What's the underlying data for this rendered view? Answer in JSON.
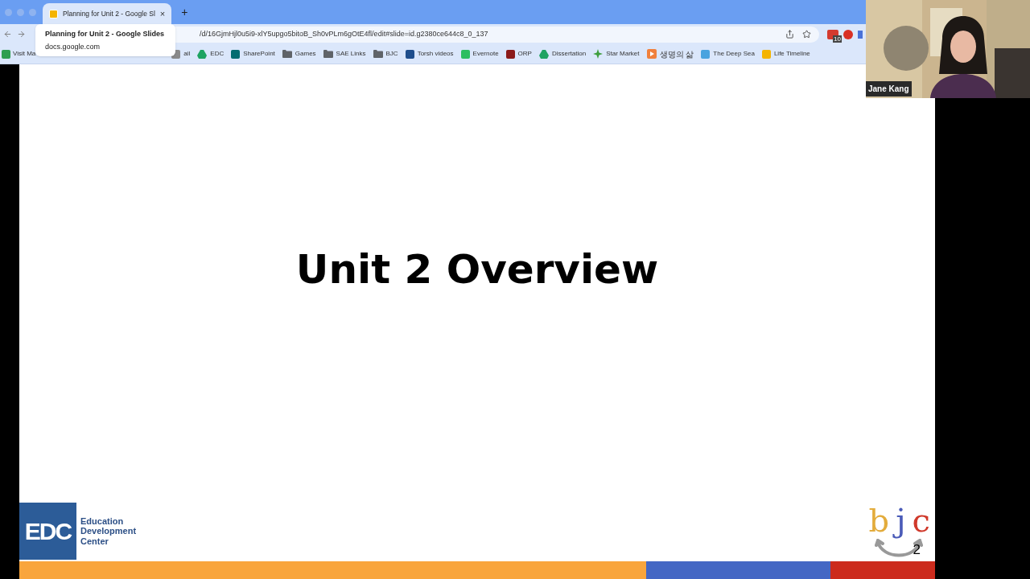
{
  "browser": {
    "tab": {
      "title": "Planning for Unit 2 - Google Sl",
      "close": "×",
      "selected": true
    },
    "new_tab": "+",
    "tooltip": {
      "title": "Planning for Unit 2 - Google Slides",
      "domain": "docs.google.com"
    },
    "url": "/d/16GjmHjl0u5i9-xlY5upgo5bitoB_Sh0vPLm6gOtE4fl/edit#slide=id.g2380ce644c8_0_137",
    "extension_badge": "10",
    "bookmarks": [
      {
        "label": "Visit Ma",
        "kind": "page",
        "color": "#2e9e4f"
      },
      {
        "label": "ail",
        "kind": "page",
        "color": "#8a8a8a"
      },
      {
        "label": "EDC",
        "kind": "drive",
        "color": "#1ea362"
      },
      {
        "label": "SharePoint",
        "kind": "page",
        "color": "#036c70"
      },
      {
        "label": "Games",
        "kind": "folder",
        "color": "#5f6368"
      },
      {
        "label": "SAE Links",
        "kind": "folder",
        "color": "#5f6368"
      },
      {
        "label": "BJC",
        "kind": "folder",
        "color": "#5f6368"
      },
      {
        "label": "Torsh videos",
        "kind": "page",
        "color": "#1f4e8c"
      },
      {
        "label": "Evernote",
        "kind": "page",
        "color": "#2dbe60"
      },
      {
        "label": "ORP",
        "kind": "page",
        "color": "#8b1a1a"
      },
      {
        "label": "Dissertation",
        "kind": "drive",
        "color": "#1ea362"
      },
      {
        "label": "Star Market",
        "kind": "star",
        "color": "#3f9e3f"
      },
      {
        "label": "생명의 삶",
        "kind": "play",
        "color": "#f0803c"
      },
      {
        "label": "The Deep Sea",
        "kind": "page",
        "color": "#4aa3df"
      },
      {
        "label": "Life Timeline",
        "kind": "page",
        "color": "#f4b400"
      }
    ]
  },
  "slide": {
    "title": "Unit 2 Overview",
    "page_number": "2",
    "edc_logo": {
      "mark": "EDC",
      "name": "Education Development Center"
    },
    "bjc_logo": [
      {
        "char": "b",
        "color": "#e3ac3c"
      },
      {
        "char": "j",
        "color": "#4a5bb8"
      },
      {
        "char": "c",
        "color": "#d0392b"
      }
    ],
    "footer_bands": [
      {
        "color": "#f9a53c"
      },
      {
        "color": "#4467c4"
      },
      {
        "color": "#cc2b1d"
      }
    ]
  },
  "video": {
    "name": "Jane Kang",
    "kind": "picture"
  }
}
